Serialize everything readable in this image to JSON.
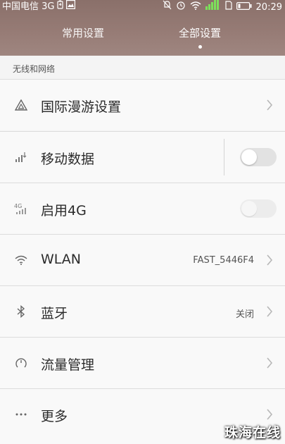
{
  "status_bar": {
    "carrier": "中国电信 3G",
    "time": "20:29"
  },
  "tabs": [
    {
      "label": "常用设置",
      "active": false
    },
    {
      "label": "全部设置",
      "active": true
    }
  ],
  "section": {
    "title": "无线和网络"
  },
  "items": [
    {
      "label": "国际漫游设置",
      "icon": "roaming-icon",
      "control": "chevron"
    },
    {
      "label": "移动数据",
      "icon": "mobile-data-icon",
      "control": "toggle",
      "on": false
    },
    {
      "label": "启用4G",
      "icon": "4g-icon",
      "control": "toggle",
      "on": false,
      "disabled": true
    },
    {
      "label": "WLAN",
      "icon": "wifi-icon",
      "value": "FAST_5446F4",
      "control": "chevron"
    },
    {
      "label": "蓝牙",
      "icon": "bluetooth-icon",
      "value": "关闭",
      "control": "chevron"
    },
    {
      "label": "流量管理",
      "icon": "traffic-icon",
      "control": "chevron"
    },
    {
      "label": "更多",
      "icon": "more-icon",
      "control": "chevron"
    }
  ],
  "watermark": "珠海在线",
  "colors": {
    "header_top": "#8a706a",
    "header_bottom": "#9f8680",
    "background": "#f4f4f4"
  }
}
